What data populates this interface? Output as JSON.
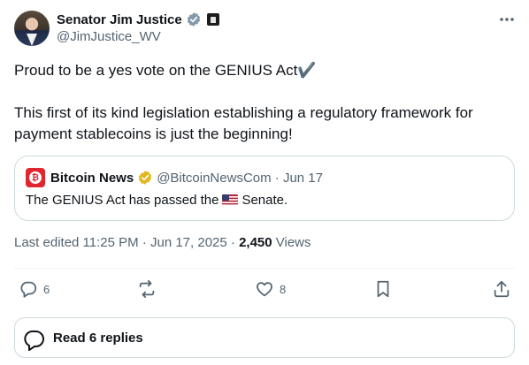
{
  "author": {
    "display_name": "Senator Jim Justice",
    "handle": "@JimJustice_WV",
    "verified_color": "#829aab",
    "affiliation_icon": "capitol-building-icon"
  },
  "post": {
    "line1": "Proud to be a yes vote on the GENIUS Act✔️",
    "line2": "This first of its kind legislation establishing a regulatory framework for payment stablecoins is just the beginning!"
  },
  "quote": {
    "display_name": "Bitcoin News",
    "handle_date": "@BitcoinNewsCom · Jun 17",
    "verified_color": "#e2b719",
    "text_before": "The GENIUS Act has passed the",
    "text_after": "Senate.",
    "flag_icon": "us-flag-icon"
  },
  "meta": {
    "edited": "Last edited 11:25 PM · Jun 17, 2025 · ",
    "views_count": "2,450",
    "views_label": " Views"
  },
  "actions": {
    "replies_count": "6",
    "likes_count": "8"
  },
  "read_replies": "Read 6 replies",
  "colors": {
    "text": "#0f1419",
    "secondary": "#536471",
    "border": "#cfd9de",
    "bitcoin_red": "#e0262f"
  }
}
